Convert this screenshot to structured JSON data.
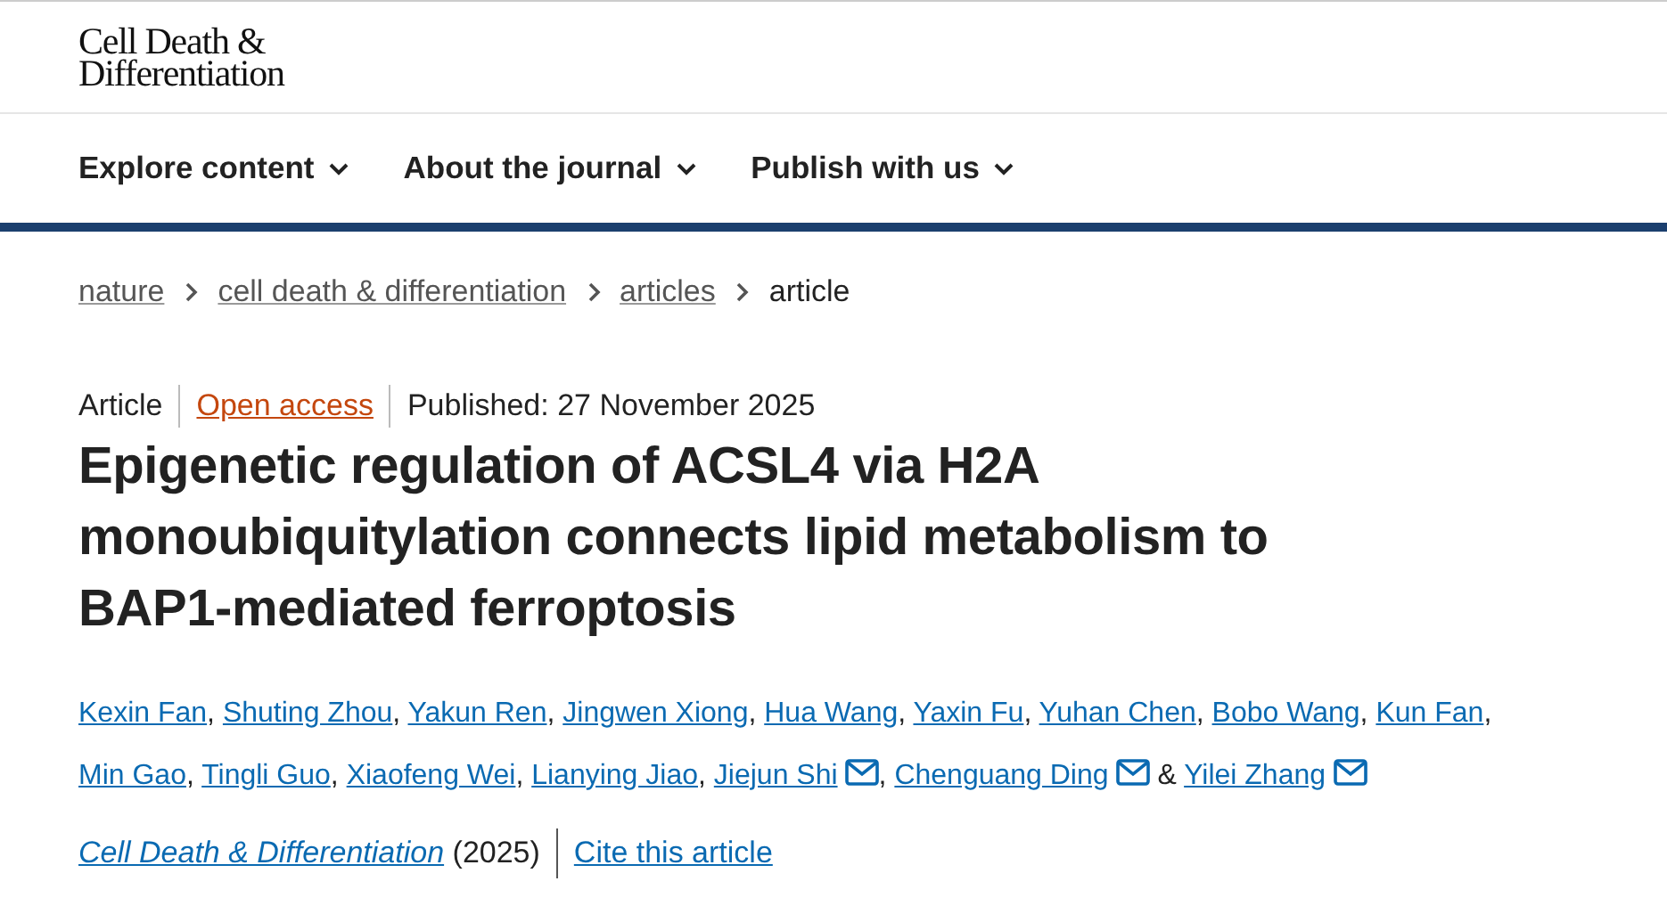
{
  "journal_logo": {
    "line_1": "Cell Death &",
    "line_2": "Differentiation"
  },
  "nav": [
    {
      "label": "Explore content"
    },
    {
      "label": "About the journal"
    },
    {
      "label": "Publish with us"
    }
  ],
  "breadcrumb": [
    {
      "label": "nature",
      "current": false
    },
    {
      "label": "cell death & differentiation",
      "current": false
    },
    {
      "label": "articles",
      "current": false
    },
    {
      "label": "article",
      "current": true
    }
  ],
  "article": {
    "type": "Article",
    "access": "Open access",
    "published": "Published: 27 November 2025",
    "title": "Epigenetic regulation of ACSL4 via H2A monoubiquitylation connects lipid metabolism to BAP1-mediated ferroptosis",
    "authors": [
      {
        "name": "Kexin Fan",
        "corresponding": false,
        "separator": ","
      },
      {
        "name": "Shuting Zhou",
        "corresponding": false,
        "separator": ","
      },
      {
        "name": "Yakun Ren",
        "corresponding": false,
        "separator": ","
      },
      {
        "name": "Jingwen Xiong",
        "corresponding": false,
        "separator": ","
      },
      {
        "name": "Hua Wang",
        "corresponding": false,
        "separator": ","
      },
      {
        "name": "Yaxin Fu",
        "corresponding": false,
        "separator": ","
      },
      {
        "name": "Yuhan Chen",
        "corresponding": false,
        "separator": ","
      },
      {
        "name": "Bobo Wang",
        "corresponding": false,
        "separator": ","
      },
      {
        "name": "Kun Fan",
        "corresponding": false,
        "separator": ","
      },
      {
        "name": "Min Gao",
        "corresponding": false,
        "separator": ","
      },
      {
        "name": "Tingli Guo",
        "corresponding": false,
        "separator": ","
      },
      {
        "name": "Xiaofeng Wei",
        "corresponding": false,
        "separator": ","
      },
      {
        "name": "Lianying Jiao",
        "corresponding": false,
        "separator": ","
      },
      {
        "name": "Jiejun Shi",
        "corresponding": true,
        "separator": ","
      },
      {
        "name": "Chenguang Ding",
        "corresponding": true,
        "separator": "&"
      },
      {
        "name": "Yilei Zhang",
        "corresponding": true
      }
    ],
    "journal": "Cell Death & Differentiation",
    "year": "(2025)",
    "cite": "Cite this article"
  }
}
